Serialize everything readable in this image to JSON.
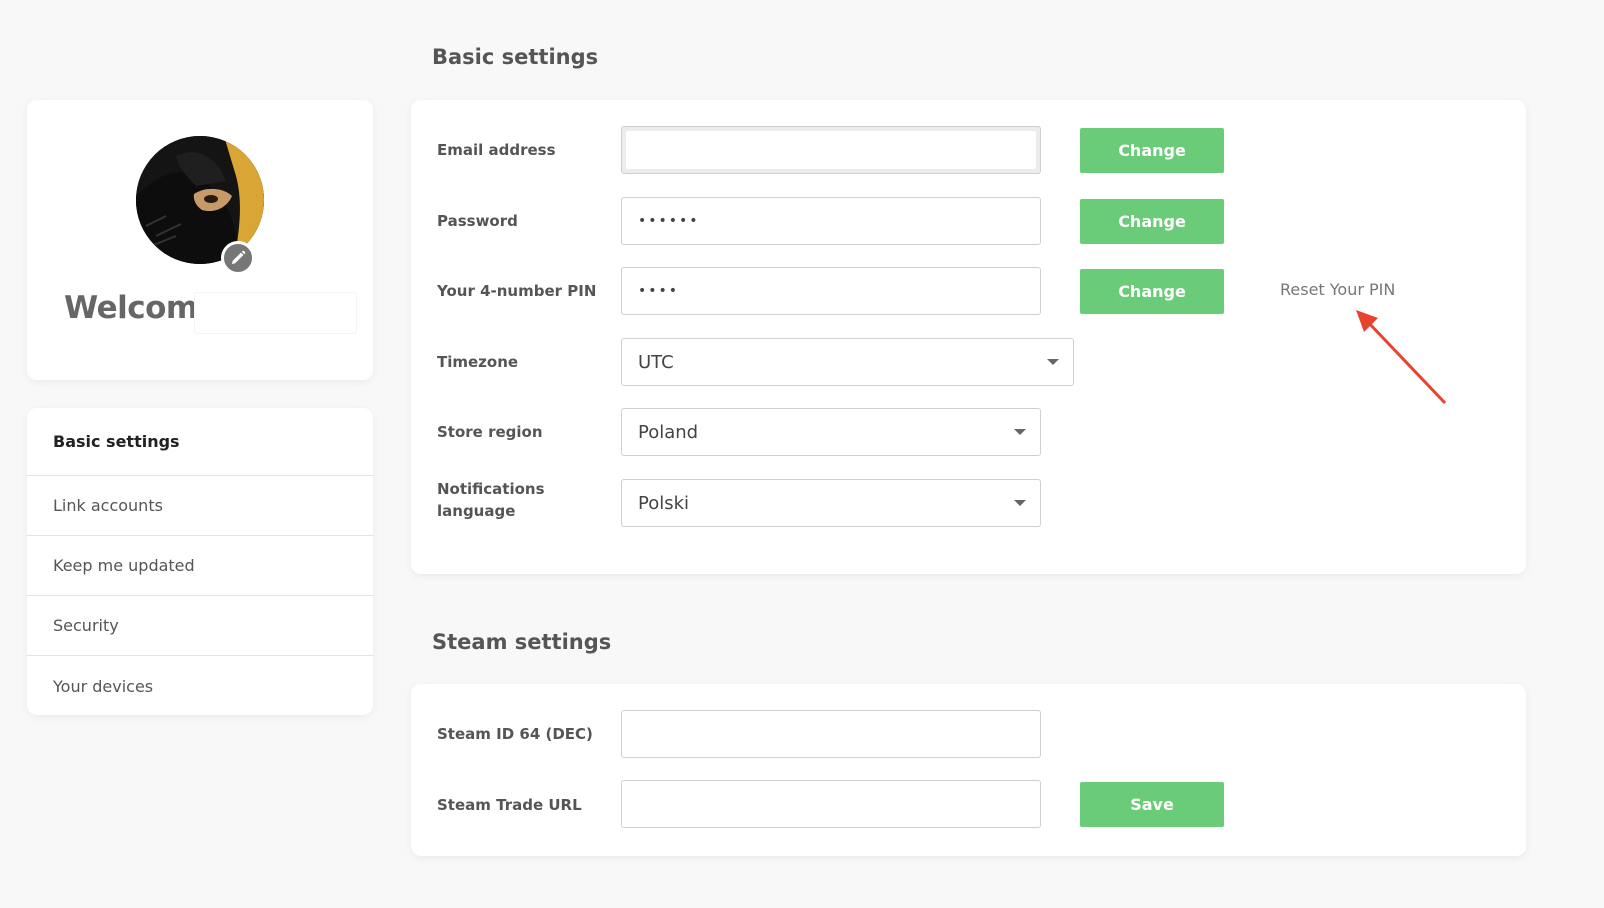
{
  "profile": {
    "welcome_label": "Welcome",
    "edit_icon": "pencil-icon"
  },
  "nav": {
    "items": [
      {
        "label": "Basic settings",
        "active": true
      },
      {
        "label": "Link accounts",
        "active": false
      },
      {
        "label": "Keep me updated",
        "active": false
      },
      {
        "label": "Security",
        "active": false
      },
      {
        "label": "Your devices",
        "active": false
      }
    ]
  },
  "basic_settings": {
    "title": "Basic settings",
    "email": {
      "label": "Email address",
      "value": "",
      "button": "Change"
    },
    "password": {
      "label": "Password",
      "value": "••••••",
      "button": "Change"
    },
    "pin": {
      "label": "Your 4-number PIN",
      "value": "••••",
      "button": "Change",
      "reset_link": "Reset Your PIN"
    },
    "timezone": {
      "label": "Timezone",
      "value": "UTC"
    },
    "store_region": {
      "label": "Store region",
      "value": "Poland"
    },
    "notifications_language": {
      "label_line1": "Notifications",
      "label_line2": "language",
      "value": "Polski"
    }
  },
  "steam_settings": {
    "title": "Steam settings",
    "steam_id": {
      "label": "Steam ID 64 (DEC)",
      "value": ""
    },
    "trade_url": {
      "label": "Steam Trade URL",
      "value": "",
      "button": "Save"
    }
  },
  "colors": {
    "accent_green": "#6acb78",
    "annotation_arrow": "#e8432d",
    "background": "#f8f8f8"
  }
}
